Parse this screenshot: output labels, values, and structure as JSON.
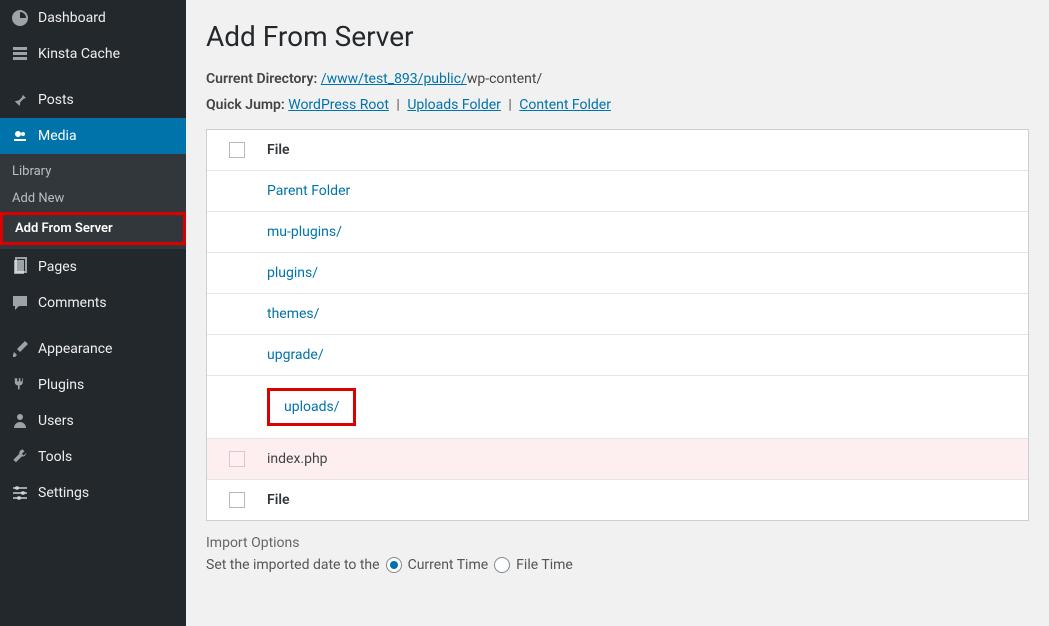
{
  "sidebar": {
    "dashboard": "Dashboard",
    "kinsta_cache": "Kinsta Cache",
    "posts": "Posts",
    "media": "Media",
    "media_sub": {
      "library": "Library",
      "add_new": "Add New",
      "add_from_server": "Add From Server"
    },
    "pages": "Pages",
    "comments": "Comments",
    "appearance": "Appearance",
    "plugins": "Plugins",
    "users": "Users",
    "tools": "Tools",
    "settings": "Settings"
  },
  "page": {
    "title": "Add From Server",
    "current_dir_label": "Current Directory:",
    "current_dir_link": "/www/test_893/public/",
    "current_dir_tail": "wp-content/",
    "quick_jump_label": "Quick Jump:",
    "quick_jump_links": {
      "wp_root": "WordPress Root",
      "uploads": "Uploads Folder",
      "content": "Content Folder"
    }
  },
  "table": {
    "header": "File",
    "rows": {
      "parent": "Parent Folder",
      "mu_plugins": "mu-plugins/",
      "plugins": "plugins/",
      "themes": "themes/",
      "upgrade": "upgrade/",
      "uploads": "uploads/",
      "index_php": "index.php"
    },
    "footer": "File"
  },
  "import": {
    "title": "Import Options",
    "date_label": "Set the imported date to the",
    "current_time": "Current Time",
    "file_time": "File Time"
  }
}
